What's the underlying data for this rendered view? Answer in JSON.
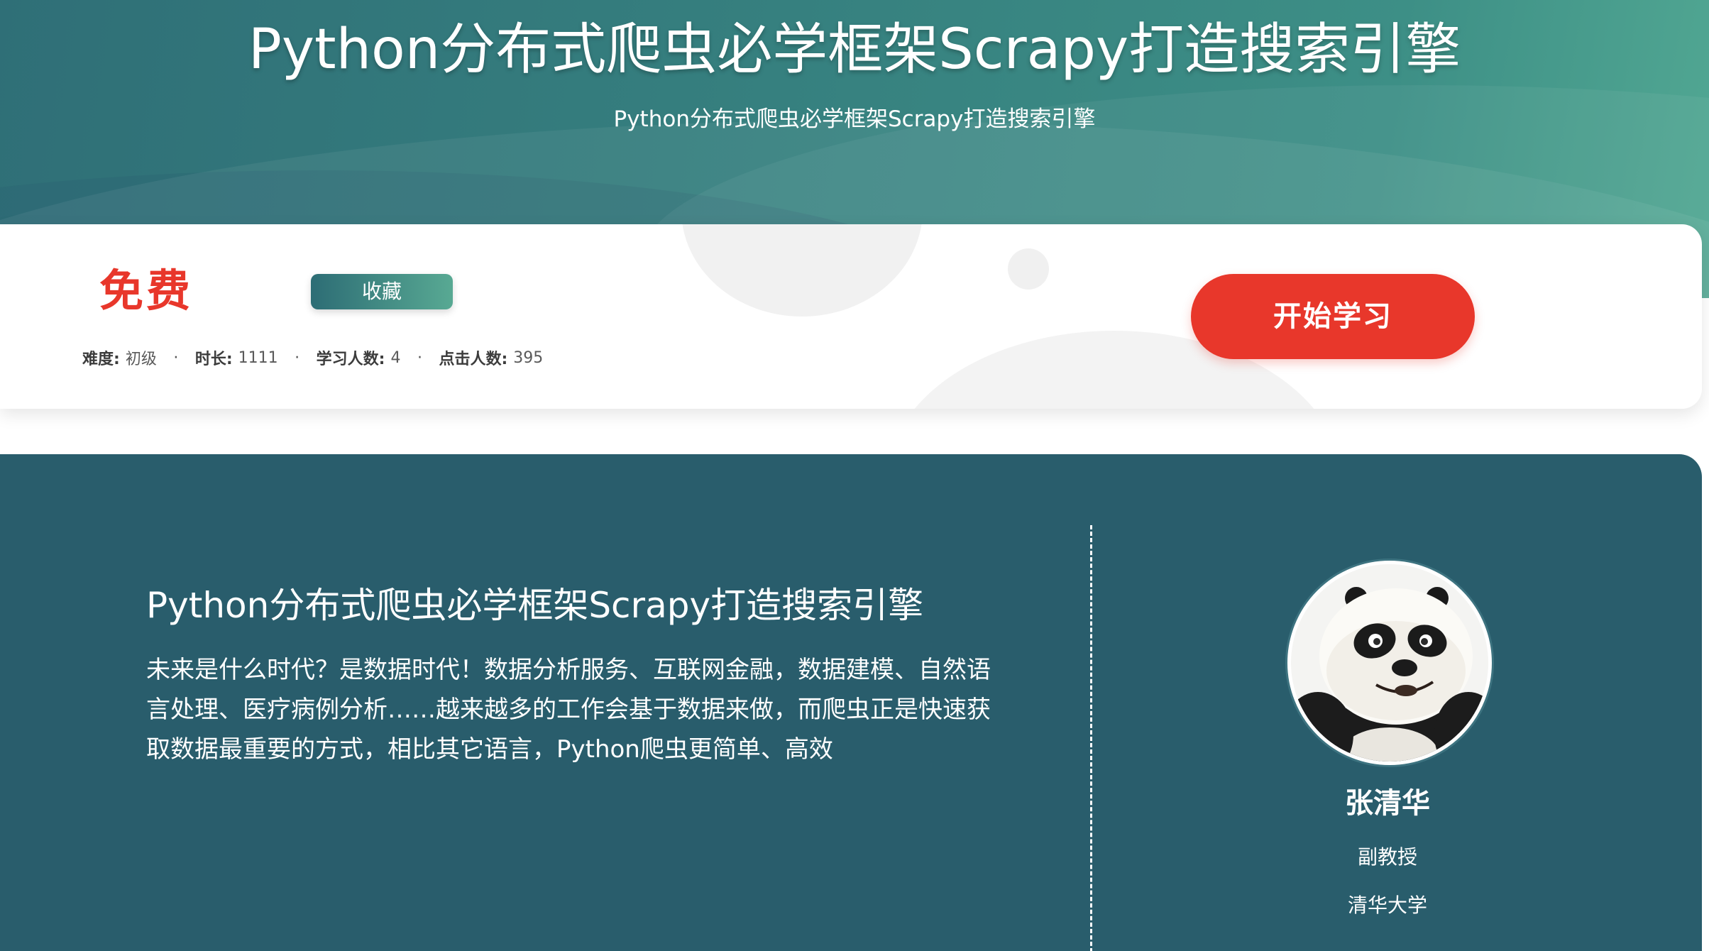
{
  "hero": {
    "title": "Python分布式爬虫必学框架Scrapy打造搜索引擎",
    "subtitle": "Python分布式爬虫必学框架Scrapy打造搜索引擎"
  },
  "info": {
    "price": "免费",
    "favorite_label": "收藏",
    "start_label": "开始学习",
    "meta": [
      {
        "label": "难度:",
        "value": "初级"
      },
      {
        "label": "时长:",
        "value": "1111"
      },
      {
        "label": "学习人数:",
        "value": "4"
      },
      {
        "label": "点击人数:",
        "value": "395"
      }
    ],
    "separator": "·"
  },
  "course": {
    "title": "Python分布式爬虫必学框架Scrapy打造搜索引擎",
    "description": "未来是什么时代？是数据时代！数据分析服务、互联网金融，数据建模、自然语言处理、医疗病例分析……越来越多的工作会基于数据来做，而爬虫正是快速获取数据最重要的方式，相比其它语言，Python爬虫更简单、高效"
  },
  "teacher": {
    "name": "张清华",
    "title": "副教授",
    "school": "清华大学",
    "avatar_icon": "panda-avatar"
  },
  "colors": {
    "hero_start": "#2f6f77",
    "hero_end": "#52a893",
    "accent_red": "#e8372b",
    "panel_bg": "#295d6c"
  }
}
